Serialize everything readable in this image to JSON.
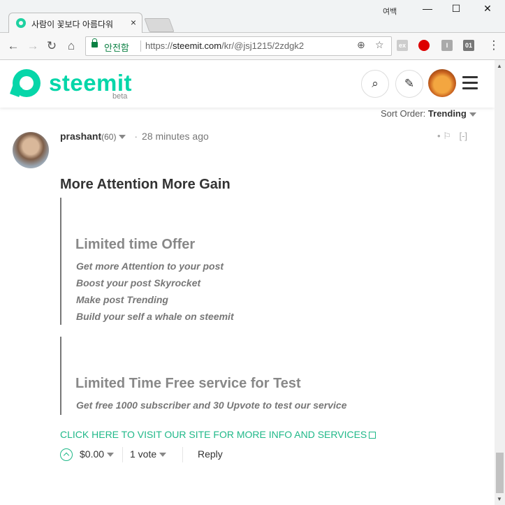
{
  "browser": {
    "tab_title": "사람이 꽃보다 아름다워",
    "tab_close": "×",
    "window_label": "여백",
    "win_min": "—",
    "win_max": "☐",
    "win_close": "✕",
    "secure_label": "안전함",
    "url_scheme": "https://",
    "url_host": "steemit.com",
    "url_path": "/kr/@jsj1215/2zdgk2",
    "ext_labels": [
      "ex",
      "",
      "I",
      "01"
    ]
  },
  "site": {
    "logo_text": "steemit",
    "logo_sub": "beta",
    "search_icon": "search-icon",
    "edit_icon": "pencil-icon"
  },
  "sort": {
    "label": "Sort Order:",
    "value": "Trending"
  },
  "comment": {
    "author": "prashant",
    "reputation": "(60)",
    "separator": "·",
    "time": "28 minutes ago",
    "flag_dot": "•",
    "collapse": "[-]",
    "title": "More Attention More Gain",
    "quote1": {
      "heading": "Limited time Offer",
      "lines": [
        "Get more Attention to your post",
        "Boost your post Skyrocket",
        "Make post Trending",
        "Build your self a whale on steemit"
      ]
    },
    "quote2": {
      "heading": "Limited Time Free service for Test",
      "lines": [
        "Get free 1000 subscriber and 30 Upvote to test our service"
      ]
    },
    "link_text": "CLICK HERE TO VISIT OUR SITE FOR MORE INFO AND SERVICES",
    "payout": "$0.00",
    "votes": "1 vote",
    "reply": "Reply"
  },
  "colors": {
    "brand": "#06d6a9",
    "link": "#1fb888"
  }
}
